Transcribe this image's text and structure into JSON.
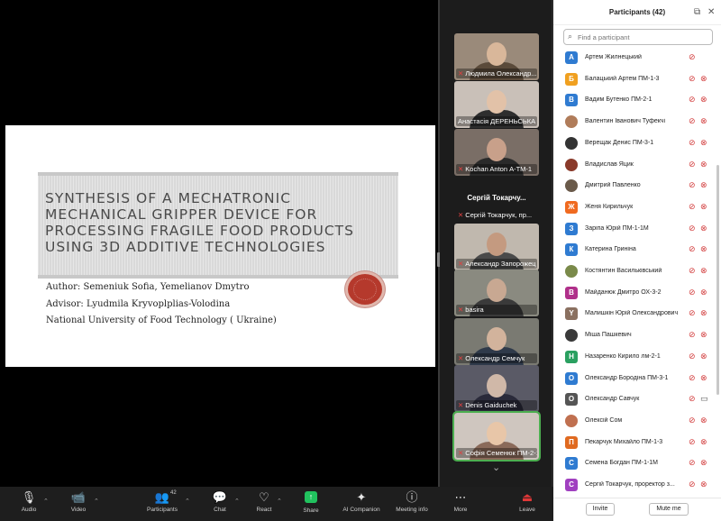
{
  "slide": {
    "title": "Synthesis of a Mechatronic Mechanical Gripper Device for Processing Fragile Food Products Using 3D Additive Technologies",
    "author": "Author: Semeniuk Sofia, Yemelianov Dmytro",
    "advisor": "Advisor: Lyudmila Kryvoplplias-Volodina",
    "institution": "National University of Food Technology ( Ukraine)"
  },
  "gallery": {
    "tiles": [
      {
        "name": "Людмила Олександр...",
        "muted": true
      },
      {
        "name": "Анастасія ДЕРЕНЬСЬКА",
        "muted": false
      },
      {
        "name": "Kochan Anton А-ТМ-1",
        "muted": true
      },
      {
        "name": "Сергій Токарчу...",
        "muted": false,
        "center": "Сергій Токарчу..."
      },
      {
        "name": "Сергій Токарчук, пр...",
        "muted": true
      },
      {
        "name": "Александр Запорожец",
        "muted": true
      },
      {
        "name": "basira",
        "muted": true
      },
      {
        "name": "Олександр Семчук",
        "muted": true
      },
      {
        "name": "Denis Gaiduchek",
        "muted": true
      },
      {
        "name": "Софія Семенюк ПМ-2-1",
        "muted": true
      }
    ],
    "more": "⌄"
  },
  "panel": {
    "title": "Participants (42)",
    "search_placeholder": "Find a participant",
    "participants": [
      {
        "initial": "A",
        "color": "#2f7bd1",
        "name": "Артем Жилнецький",
        "cam": false
      },
      {
        "initial": "Б",
        "color": "#f0a020",
        "name": "Балацький Артем ПМ-1-3",
        "cam": true
      },
      {
        "initial": "В",
        "color": "#2f7bd1",
        "name": "Вадим Бутенко ПМ-2-1",
        "cam": true
      },
      {
        "initial": "",
        "color": "#b07c5a",
        "name": "Валентин Іванович Туфекчі",
        "cam": true
      },
      {
        "initial": "",
        "color": "#333333",
        "name": "Верещак Денис ПМ-3-1",
        "cam": true
      },
      {
        "initial": "",
        "color": "#8a3a2a",
        "name": "Владислав Яцик",
        "cam": true
      },
      {
        "initial": "",
        "color": "#6a5a4a",
        "name": "Дмитрий Павленко",
        "cam": true
      },
      {
        "initial": "Ж",
        "color": "#f06a20",
        "name": "Женя Кирильчук",
        "cam": true
      },
      {
        "initial": "З",
        "color": "#2f7bd1",
        "name": "Заріпа Юрій ПМ-1-1М",
        "cam": true
      },
      {
        "initial": "К",
        "color": "#2f7bd1",
        "name": "Катерина Гриніна",
        "cam": true
      },
      {
        "initial": "",
        "color": "#7a8a4a",
        "name": "Костянтин Васильківський",
        "cam": true
      },
      {
        "initial": "В",
        "color": "#b0308a",
        "name": "Майданюк Дмитро ОХ-3-2",
        "cam": true
      },
      {
        "initial": "Y",
        "color": "#8a7060",
        "name": "Малишкін Юрій Олександрович",
        "cam": true
      },
      {
        "initial": "",
        "color": "#3a3a3a",
        "name": "Міша Пашкевич",
        "cam": true
      },
      {
        "initial": "Н",
        "color": "#2aa060",
        "name": "Назаренко Кирило лм-2-1",
        "cam": true
      },
      {
        "initial": "О",
        "color": "#2f7bd1",
        "name": "Олександр Бородіна ПМ-3-1",
        "cam": true
      },
      {
        "initial": "О",
        "color": "#555555",
        "name": "Олександр Савчук",
        "cam": "on"
      },
      {
        "initial": "",
        "color": "#c07050",
        "name": "Олексій Сом",
        "cam": true
      },
      {
        "initial": "П",
        "color": "#e06a20",
        "name": "Пекарчук Михайло ПМ-1-3",
        "cam": true
      },
      {
        "initial": "С",
        "color": "#2f7bd1",
        "name": "Семена Богдан ПМ-1-1М",
        "cam": true
      },
      {
        "initial": "С",
        "color": "#a040c0",
        "name": "Сергій Токарчук, проректор з...",
        "cam": true
      }
    ],
    "invite": "Invite",
    "mute_me": "Mute me"
  },
  "toolbar": {
    "audio": "Audio",
    "video": "Video",
    "participants": "Participants",
    "participants_count": "42",
    "chat": "Chat",
    "react": "React",
    "share": "Share",
    "ai": "AI Companion",
    "meeting_info": "Meeting info",
    "more": "More",
    "leave": "Leave"
  },
  "icons": {
    "audio": "microphone-icon",
    "video": "video-camera-icon",
    "participants": "people-icon",
    "chat": "chat-bubble-icon",
    "react": "heart-icon",
    "share": "share-arrow-icon",
    "ai": "sparkle-icon",
    "meeting_info": "info-icon",
    "more": "ellipsis-icon",
    "leave": "leave-icon",
    "pop_out": "pop-out-icon",
    "close": "close-icon",
    "search": "search-icon"
  }
}
